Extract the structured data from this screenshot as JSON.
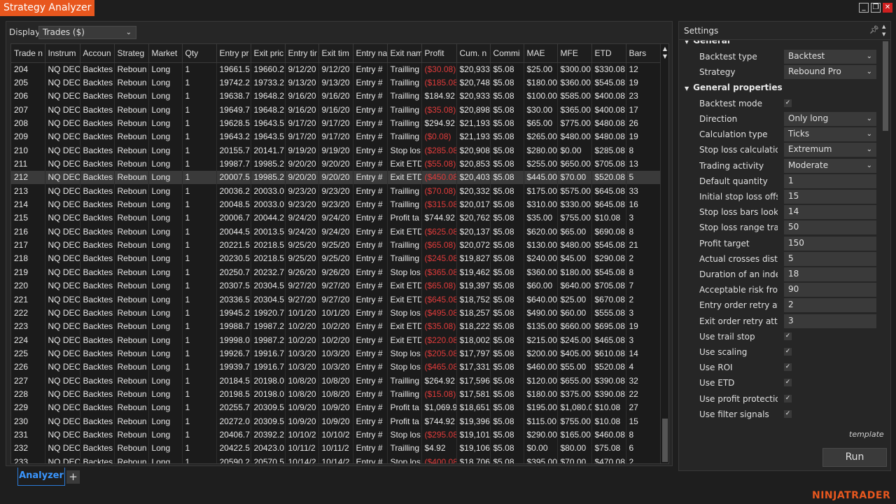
{
  "app": {
    "title": "Strategy Analyzer",
    "brand": "NINJATRADER"
  },
  "window_controls": {
    "minimize_icon": "minimize-icon",
    "restore_icon": "restore-icon",
    "close_icon": "close-icon"
  },
  "colors": {
    "accent": "#e8571e",
    "negative": "#e03b3b",
    "tab_active": "#3a96ff",
    "selected_row": "#3a3a3a"
  },
  "display": {
    "label": "Display",
    "value": "Trades ($)"
  },
  "grid": {
    "columns": [
      "Trade n",
      "Instrum",
      "Accoun",
      "Strateg",
      "Market",
      "Qty",
      "Entry pr",
      "Exit pric",
      "Entry tir",
      "Exit tim",
      "Entry na",
      "Exit nam",
      "Profit",
      "Cum. n",
      "Commi",
      "MAE",
      "MFE",
      "ETD",
      "Bars"
    ],
    "selected_row_index": 8,
    "rows": [
      [
        "204",
        "NQ DEC",
        "Backtes",
        "Reboun",
        "Long",
        "1",
        "19661.5",
        "19660.2",
        "9/12/20",
        "9/12/20",
        "Entry #",
        "Trailling",
        "($30.08)",
        "$20,933",
        "$5.08",
        "$25.00",
        "$300.00",
        "$330.08",
        "12"
      ],
      [
        "205",
        "NQ DEC",
        "Backtes",
        "Reboun",
        "Long",
        "1",
        "19742.2",
        "19733.2",
        "9/13/20",
        "9/13/20",
        "Entry #",
        "Trailling",
        "($185.08)",
        "$20,748",
        "$5.08",
        "$180.00",
        "$360.00",
        "$545.08",
        "19"
      ],
      [
        "206",
        "NQ DEC",
        "Backtes",
        "Reboun",
        "Long",
        "1",
        "19638.7",
        "19648.2",
        "9/16/20",
        "9/16/20",
        "Entry #",
        "Trailling",
        "$184.92",
        "$20,933",
        "$5.08",
        "$100.00",
        "$585.00",
        "$400.08",
        "23"
      ],
      [
        "207",
        "NQ DEC",
        "Backtes",
        "Reboun",
        "Long",
        "1",
        "19649.7",
        "19648.2",
        "9/16/20",
        "9/16/20",
        "Entry #",
        "Trailling",
        "($35.08)",
        "$20,898",
        "$5.08",
        "$30.00",
        "$365.00",
        "$400.08",
        "17"
      ],
      [
        "208",
        "NQ DEC",
        "Backtes",
        "Reboun",
        "Long",
        "1",
        "19628.5",
        "19643.5",
        "9/17/20",
        "9/17/20",
        "Entry #",
        "Trailling",
        "$294.92",
        "$21,193",
        "$5.08",
        "$65.00",
        "$775.00",
        "$480.08",
        "26"
      ],
      [
        "209",
        "NQ DEC",
        "Backtes",
        "Reboun",
        "Long",
        "1",
        "19643.2",
        "19643.5",
        "9/17/20",
        "9/17/20",
        "Entry #",
        "Trailling",
        "($0.08)",
        "$21,193",
        "$5.08",
        "$265.00",
        "$480.00",
        "$480.08",
        "19"
      ],
      [
        "210",
        "NQ DEC",
        "Backtes",
        "Reboun",
        "Long",
        "1",
        "20155.7",
        "20141.7",
        "9/19/20",
        "9/19/20",
        "Entry #",
        "Stop los",
        "($285.08)",
        "$20,908",
        "$5.08",
        "$280.00",
        "$0.00",
        "$285.08",
        "8"
      ],
      [
        "211",
        "NQ DEC",
        "Backtes",
        "Reboun",
        "Long",
        "1",
        "19987.7",
        "19985.2",
        "9/20/20",
        "9/20/20",
        "Entry #",
        "Exit ETD",
        "($55.08)",
        "$20,853",
        "$5.08",
        "$255.00",
        "$650.00",
        "$705.08",
        "13"
      ],
      [
        "212",
        "NQ DEC",
        "Backtes",
        "Reboun",
        "Long",
        "1",
        "20007.5",
        "19985.2",
        "9/20/20",
        "9/20/20",
        "Entry #",
        "Exit ETD",
        "($450.08)",
        "$20,403",
        "$5.08",
        "$445.00",
        "$70.00",
        "$520.08",
        "5"
      ],
      [
        "213",
        "NQ DEC",
        "Backtes",
        "Reboun",
        "Long",
        "1",
        "20036.2",
        "20033.0",
        "9/23/20",
        "9/23/20",
        "Entry #",
        "Trailling",
        "($70.08)",
        "$20,332",
        "$5.08",
        "$175.00",
        "$575.00",
        "$645.08",
        "33"
      ],
      [
        "214",
        "NQ DEC",
        "Backtes",
        "Reboun",
        "Long",
        "1",
        "20048.5",
        "20033.0",
        "9/23/20",
        "9/23/20",
        "Entry #",
        "Trailling",
        "($315.08)",
        "$20,017",
        "$5.08",
        "$310.00",
        "$330.00",
        "$645.08",
        "16"
      ],
      [
        "215",
        "NQ DEC",
        "Backtes",
        "Reboun",
        "Long",
        "1",
        "20006.7",
        "20044.2",
        "9/24/20",
        "9/24/20",
        "Entry #",
        "Profit ta",
        "$744.92",
        "$20,762",
        "$5.08",
        "$35.00",
        "$755.00",
        "$10.08",
        "3"
      ],
      [
        "216",
        "NQ DEC",
        "Backtes",
        "Reboun",
        "Long",
        "1",
        "20044.5",
        "20013.5",
        "9/24/20",
        "9/24/20",
        "Entry #",
        "Exit ETD",
        "($625.08)",
        "$20,137",
        "$5.08",
        "$620.00",
        "$65.00",
        "$690.08",
        "8"
      ],
      [
        "217",
        "NQ DEC",
        "Backtes",
        "Reboun",
        "Long",
        "1",
        "20221.5",
        "20218.5",
        "9/25/20",
        "9/25/20",
        "Entry #",
        "Trailling",
        "($65.08)",
        "$20,072",
        "$5.08",
        "$130.00",
        "$480.00",
        "$545.08",
        "21"
      ],
      [
        "218",
        "NQ DEC",
        "Backtes",
        "Reboun",
        "Long",
        "1",
        "20230.5",
        "20218.5",
        "9/25/20",
        "9/25/20",
        "Entry #",
        "Trailling",
        "($245.08)",
        "$19,827",
        "$5.08",
        "$240.00",
        "$45.00",
        "$290.08",
        "2"
      ],
      [
        "219",
        "NQ DEC",
        "Backtes",
        "Reboun",
        "Long",
        "1",
        "20250.7",
        "20232.7",
        "9/26/20",
        "9/26/20",
        "Entry #",
        "Stop los",
        "($365.08)",
        "$19,462",
        "$5.08",
        "$360.00",
        "$180.00",
        "$545.08",
        "8"
      ],
      [
        "220",
        "NQ DEC",
        "Backtes",
        "Reboun",
        "Long",
        "1",
        "20307.5",
        "20304.5",
        "9/27/20",
        "9/27/20",
        "Entry #",
        "Exit ETD",
        "($65.08)",
        "$19,397",
        "$5.08",
        "$60.00",
        "$640.00",
        "$705.08",
        "7"
      ],
      [
        "221",
        "NQ DEC",
        "Backtes",
        "Reboun",
        "Long",
        "1",
        "20336.5",
        "20304.5",
        "9/27/20",
        "9/27/20",
        "Entry #",
        "Exit ETD",
        "($645.08)",
        "$18,752",
        "$5.08",
        "$640.00",
        "$25.00",
        "$670.08",
        "2"
      ],
      [
        "222",
        "NQ DEC",
        "Backtes",
        "Reboun",
        "Long",
        "1",
        "19945.2",
        "19920.7",
        "10/1/20",
        "10/1/20",
        "Entry #",
        "Stop los",
        "($495.08)",
        "$18,257",
        "$5.08",
        "$490.00",
        "$60.00",
        "$555.08",
        "3"
      ],
      [
        "223",
        "NQ DEC",
        "Backtes",
        "Reboun",
        "Long",
        "1",
        "19988.7",
        "19987.2",
        "10/2/20",
        "10/2/20",
        "Entry #",
        "Exit ETD",
        "($35.08)",
        "$18,222",
        "$5.08",
        "$135.00",
        "$660.00",
        "$695.08",
        "19"
      ],
      [
        "224",
        "NQ DEC",
        "Backtes",
        "Reboun",
        "Long",
        "1",
        "19998.0",
        "19987.2",
        "10/2/20",
        "10/2/20",
        "Entry #",
        "Exit ETD",
        "($220.08)",
        "$18,002",
        "$5.08",
        "$215.00",
        "$245.00",
        "$465.08",
        "3"
      ],
      [
        "225",
        "NQ DEC",
        "Backtes",
        "Reboun",
        "Long",
        "1",
        "19926.7",
        "19916.7",
        "10/3/20",
        "10/3/20",
        "Entry #",
        "Stop los",
        "($205.08)",
        "$17,797",
        "$5.08",
        "$200.00",
        "$405.00",
        "$610.08",
        "14"
      ],
      [
        "226",
        "NQ DEC",
        "Backtes",
        "Reboun",
        "Long",
        "1",
        "19939.7",
        "19916.7",
        "10/3/20",
        "10/3/20",
        "Entry #",
        "Stop los",
        "($465.08)",
        "$17,331",
        "$5.08",
        "$460.00",
        "$55.00",
        "$520.08",
        "4"
      ],
      [
        "227",
        "NQ DEC",
        "Backtes",
        "Reboun",
        "Long",
        "1",
        "20184.5",
        "20198.0",
        "10/8/20",
        "10/8/20",
        "Entry #",
        "Trailling",
        "$264.92",
        "$17,596",
        "$5.08",
        "$120.00",
        "$655.00",
        "$390.08",
        "32"
      ],
      [
        "228",
        "NQ DEC",
        "Backtes",
        "Reboun",
        "Long",
        "1",
        "20198.5",
        "20198.0",
        "10/8/20",
        "10/8/20",
        "Entry #",
        "Trailling",
        "($15.08)",
        "$17,581",
        "$5.08",
        "$180.00",
        "$375.00",
        "$390.08",
        "22"
      ],
      [
        "229",
        "NQ DEC",
        "Backtes",
        "Reboun",
        "Long",
        "1",
        "20255.7",
        "20309.5",
        "10/9/20",
        "10/9/20",
        "Entry #",
        "Profit ta",
        "$1,069.9",
        "$18,651",
        "$5.08",
        "$195.00",
        "$1,080.0",
        "$10.08",
        "27"
      ],
      [
        "230",
        "NQ DEC",
        "Backtes",
        "Reboun",
        "Long",
        "1",
        "20272.0",
        "20309.5",
        "10/9/20",
        "10/9/20",
        "Entry #",
        "Profit ta",
        "$744.92",
        "$19,396",
        "$5.08",
        "$115.00",
        "$755.00",
        "$10.08",
        "15"
      ],
      [
        "231",
        "NQ DEC",
        "Backtes",
        "Reboun",
        "Long",
        "1",
        "20406.7",
        "20392.2",
        "10/10/2",
        "10/10/2",
        "Entry #",
        "Stop los",
        "($295.08)",
        "$19,101",
        "$5.08",
        "$290.00",
        "$165.00",
        "$460.08",
        "8"
      ],
      [
        "232",
        "NQ DEC",
        "Backtes",
        "Reboun",
        "Long",
        "1",
        "20422.5",
        "20423.0",
        "10/11/2",
        "10/11/2",
        "Entry #",
        "Trailling",
        "$4.92",
        "$19,106",
        "$5.08",
        "$0.00",
        "$80.00",
        "$75.08",
        "6"
      ],
      [
        "233",
        "NQ DEC",
        "Backtes",
        "Reboun",
        "Long",
        "1",
        "20590.2",
        "20570.5",
        "10/14/2",
        "10/14/2",
        "Entry #",
        "Stop los",
        "($400.08)",
        "$18,706",
        "$5.08",
        "$395.00",
        "$70.00",
        "$470.08",
        "2"
      ]
    ]
  },
  "tabs": {
    "active": "Analyzer",
    "add_label": "+"
  },
  "settings": {
    "title": "Settings",
    "template_label": "template",
    "run_label": "Run",
    "rows": [
      {
        "type": "category",
        "label": "General",
        "partial": true
      },
      {
        "type": "select",
        "label": "Backtest type",
        "value": "Backtest"
      },
      {
        "type": "select",
        "label": "Strategy",
        "value": "Rebound Pro"
      },
      {
        "type": "category",
        "label": "General properties"
      },
      {
        "type": "check",
        "label": "Backtest mode",
        "checked": true
      },
      {
        "type": "select",
        "label": "Direction",
        "value": "Only long"
      },
      {
        "type": "select",
        "label": "Calculation type",
        "value": "Ticks"
      },
      {
        "type": "select",
        "label": "Stop loss calculation...",
        "value": "Extremum"
      },
      {
        "type": "select",
        "label": "Trading activity",
        "value": "Moderate"
      },
      {
        "type": "text",
        "label": "Default quantity",
        "value": "1"
      },
      {
        "type": "text",
        "label": "Initial stop loss offset",
        "value": "15"
      },
      {
        "type": "text",
        "label": "Stop loss bars look b...",
        "value": "14"
      },
      {
        "type": "text",
        "label": "Stop loss range trail...",
        "value": "50"
      },
      {
        "type": "text",
        "label": "Profit target",
        "value": "150"
      },
      {
        "type": "text",
        "label": "Actual crosses dista...",
        "value": "5"
      },
      {
        "type": "text",
        "label": "Duration of an indef...",
        "value": "18"
      },
      {
        "type": "text",
        "label": "Acceptable risk fro...",
        "value": "90"
      },
      {
        "type": "text",
        "label": "Entry order retry atte...",
        "value": "2"
      },
      {
        "type": "text",
        "label": "Exit order retry atte...",
        "value": "3"
      },
      {
        "type": "check",
        "label": "Use trail stop",
        "checked": true
      },
      {
        "type": "check",
        "label": "Use scaling",
        "checked": true
      },
      {
        "type": "check",
        "label": "Use ROI",
        "checked": true
      },
      {
        "type": "check",
        "label": "Use ETD",
        "checked": true
      },
      {
        "type": "check",
        "label": "Use profit protection",
        "checked": true
      },
      {
        "type": "check",
        "label": "Use filter signals",
        "checked": true,
        "partial": true
      }
    ]
  }
}
